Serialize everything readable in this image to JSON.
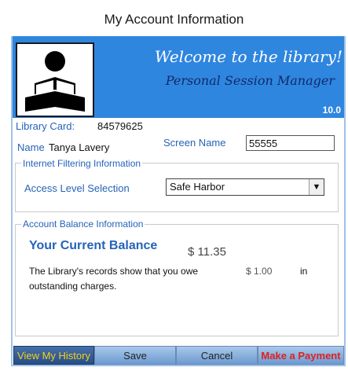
{
  "window": {
    "title": "My Account Information"
  },
  "banner": {
    "title": "Welcome to the library!",
    "subtitle": "Personal Session Manager",
    "version": "10.0",
    "logo_icon": "person-reading-book-icon",
    "color": "#2f86df"
  },
  "account": {
    "library_card_label": "Library Card:",
    "library_card_value": "84579625",
    "name_label": "Name",
    "name_value": "Tanya Lavery",
    "screen_name_label": "Screen Name",
    "screen_name_value": "55555"
  },
  "filtering": {
    "group_title": "Internet Filtering Information",
    "access_label": "Access Level Selection",
    "access_value": "Safe Harbor"
  },
  "balance": {
    "group_title": "Account Balance Information",
    "title": "Your Current Balance",
    "amount": "$ 11.35",
    "message_prefix": "The Library's records show that you owe",
    "owe_amount": "$ 1.00",
    "message_in": "in",
    "message_suffix": "outstanding charges."
  },
  "buttons": {
    "view_history": "View My History",
    "save": "Save",
    "cancel": "Cancel",
    "make_payment": "Make a Payment"
  },
  "colors": {
    "accent_blue": "#2563b9",
    "history_text": "#f2d21b",
    "payment_text": "#e02020"
  }
}
